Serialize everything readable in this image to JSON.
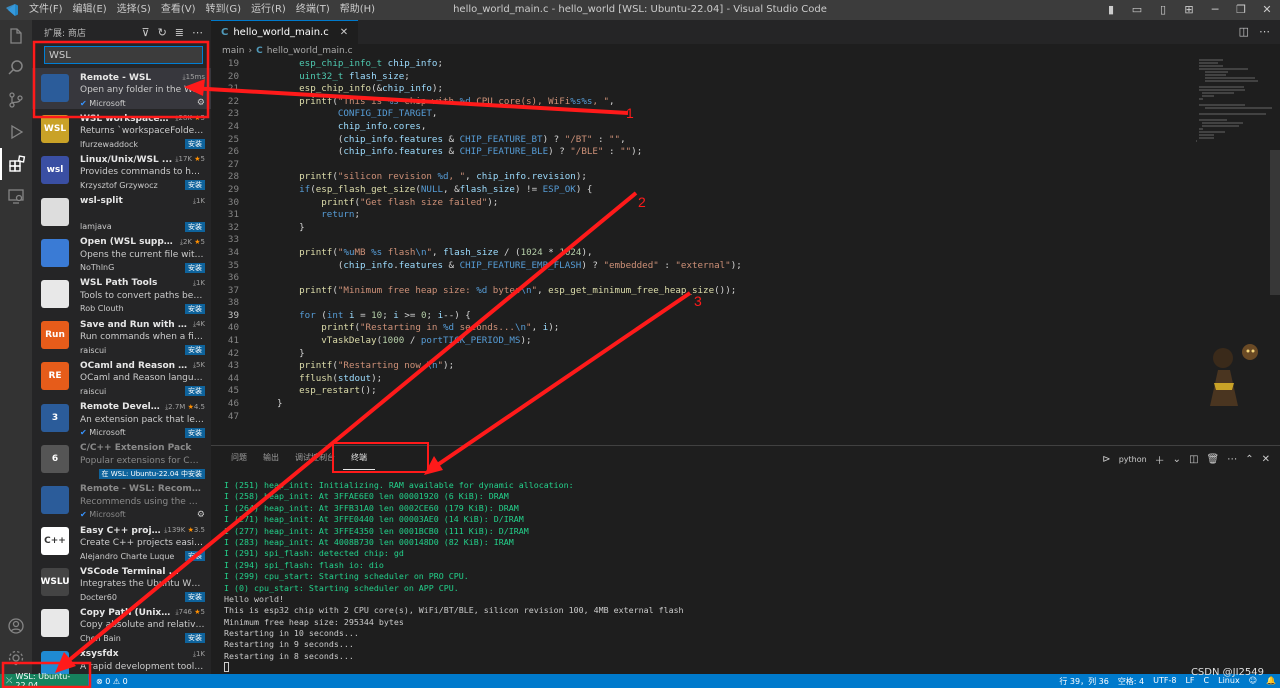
{
  "titlebar": {
    "menu": [
      "文件(F)",
      "编辑(E)",
      "选择(S)",
      "查看(V)",
      "转到(G)",
      "运行(R)",
      "终端(T)",
      "帮助(H)"
    ],
    "window_title": "hello_world_main.c - hello_world [WSL: Ubuntu-22.04] - Visual Studio Code"
  },
  "sidebar": {
    "title": "扩展: 商店",
    "search_value": "WSL",
    "extensions": [
      {
        "name": "Remote - WSL",
        "meta": "15ms",
        "desc": "Open any folder in the Windo...",
        "publisher": "Microsoft",
        "verified": true,
        "action": "gear",
        "icon_text": "",
        "icon_color": "#2b5c9a",
        "selected": true
      },
      {
        "name": "WSL workspaceF...",
        "meta": "28K",
        "rating": "5",
        "desc": "Returns `workspaceFolder` as a...",
        "publisher": "lfurzewaddock",
        "action": "安装",
        "icon_text": "WSL",
        "icon_color": "#c9a227"
      },
      {
        "name": "Linux/Unix/WSL ...",
        "meta": "17K",
        "rating": "5",
        "desc": "Provides commands to have u...",
        "publisher": "Krzysztof Grzywocz",
        "action": "安装",
        "icon_text": "wsl",
        "icon_color": "#3a4fa3"
      },
      {
        "name": "wsl-split",
        "meta": "1K",
        "desc": "",
        "publisher": "lamjava",
        "action": "安装",
        "icon_text": "",
        "icon_color": "#dddddd"
      },
      {
        "name": "Open (WSL support)",
        "meta": "2K",
        "rating": "5",
        "desc": "Opens the current file with the...",
        "publisher": "NoThlnG",
        "action": "安装",
        "icon_text": "",
        "icon_color": "#3a7bd5"
      },
      {
        "name": "WSL Path Tools",
        "meta": "1K",
        "desc": "Tools to convert paths betwee...",
        "publisher": "Rob Clouth",
        "action": "安装",
        "icon_text": "",
        "icon_color": "#e8e8e8"
      },
      {
        "name": "Save and Run with wsl",
        "meta": "4K",
        "desc": "Run commands when a file is s...",
        "publisher": "raiscui",
        "action": "安装",
        "icon_text": "Run",
        "icon_color": "#e65c1a"
      },
      {
        "name": "OCaml and Reason ID...",
        "meta": "5K",
        "desc": "OCaml and Reason language s...",
        "publisher": "raiscui",
        "action": "安装",
        "icon_text": "RE",
        "icon_color": "#e65c1a"
      },
      {
        "name": "Remote Develo...",
        "meta": "2.7M",
        "rating": "4.5",
        "desc": "An extension pack that lets yo...",
        "publisher": "Microsoft",
        "verified": true,
        "action": "安装",
        "icon_text": "3",
        "icon_color": "#2b5c9a"
      },
      {
        "name": "C/C++ Extension Pack",
        "meta": "",
        "desc": "Popular extensions for C++ de...",
        "publisher": "",
        "action": "在 WSL: Ubuntu-22.04 中安装",
        "icon_text": "6",
        "icon_color": "#555555",
        "dim": true
      },
      {
        "name": "Remote - WSL: Recommender",
        "meta": "",
        "desc": "Recommends using the Windo...",
        "publisher": "Microsoft",
        "verified": true,
        "action": "gear",
        "icon_text": "",
        "icon_color": "#2b5c9a",
        "dim": true
      },
      {
        "name": "Easy C++ proje...",
        "meta": "139K",
        "rating": "3.5",
        "desc": "Create C++ projects easily for ...",
        "publisher": "Alejandro Charte Luque",
        "action": "安装",
        "icon_text": "C++",
        "icon_color": "#ffffff"
      },
      {
        "name": "VSCode Terminal ...",
        "meta": "",
        "desc": "Integrates the Ubuntu WSL int...",
        "publisher": "Docter60",
        "action": "安装",
        "icon_text": "WSLU",
        "icon_color": "#444444"
      },
      {
        "name": "Copy Path (Unix ...",
        "meta": "746",
        "rating": "5",
        "desc": "Copy absolute and relative Wi...",
        "publisher": "Chen Bain",
        "action": "安装",
        "icon_text": "",
        "icon_color": "#e8e8e8"
      },
      {
        "name": "xsysfdx",
        "meta": "1K",
        "desc": "A rapid development tool for ...",
        "publisher": "",
        "action": "",
        "icon_text": "",
        "icon_color": "#1f8ad2"
      }
    ]
  },
  "editor": {
    "tab_label": "hello_world_main.c",
    "breadcrumb": [
      "main",
      "hello_world_main.c"
    ],
    "lines": [
      {
        "n": "19",
        "t": "    esp_chip_info_t chip_info;"
      },
      {
        "n": "20",
        "t": "    uint32_t flash_size;"
      },
      {
        "n": "21",
        "t": "    esp_chip_info(&chip_info);"
      },
      {
        "n": "22",
        "t": "    printf(\"This is %s chip with %d CPU core(s), WiFi%s%s, \","
      },
      {
        "n": "23",
        "t": "           CONFIG_IDF_TARGET,"
      },
      {
        "n": "24",
        "t": "           chip_info.cores,"
      },
      {
        "n": "25",
        "t": "           (chip_info.features & CHIP_FEATURE_BT) ? \"/BT\" : \"\","
      },
      {
        "n": "26",
        "t": "           (chip_info.features & CHIP_FEATURE_BLE) ? \"/BLE\" : \"\");"
      },
      {
        "n": "27",
        "t": ""
      },
      {
        "n": "28",
        "t": "    printf(\"silicon revision %d, \", chip_info.revision);"
      },
      {
        "n": "29",
        "t": "    if(esp_flash_get_size(NULL, &flash_size) != ESP_OK) {"
      },
      {
        "n": "30",
        "t": "        printf(\"Get flash size failed\");"
      },
      {
        "n": "31",
        "t": "        return;"
      },
      {
        "n": "32",
        "t": "    }"
      },
      {
        "n": "33",
        "t": ""
      },
      {
        "n": "34",
        "t": "    printf(\"%uMB %s flash\\n\", flash_size / (1024 * 1024),"
      },
      {
        "n": "35",
        "t": "           (chip_info.features & CHIP_FEATURE_EMB_FLASH) ? \"embedded\" : \"external\");"
      },
      {
        "n": "36",
        "t": ""
      },
      {
        "n": "37",
        "t": "    printf(\"Minimum free heap size: %d bytes\\n\", esp_get_minimum_free_heap_size());"
      },
      {
        "n": "38",
        "t": ""
      },
      {
        "n": "39",
        "t": "    for (int i = 10; i >= 0; i--) {"
      },
      {
        "n": "40",
        "t": "        printf(\"Restarting in %d seconds...\\n\", i);"
      },
      {
        "n": "41",
        "t": "        vTaskDelay(1000 / portTICK_PERIOD_MS);"
      },
      {
        "n": "42",
        "t": "    }"
      },
      {
        "n": "43",
        "t": "    printf(\"Restarting now.\\n\");"
      },
      {
        "n": "44",
        "t": "    fflush(stdout);"
      },
      {
        "n": "45",
        "t": "    esp_restart();"
      },
      {
        "n": "46",
        "t": "}"
      },
      {
        "n": "47",
        "t": ""
      }
    ]
  },
  "panel": {
    "tabs": [
      "问题",
      "输出",
      "调试控制台",
      "终端"
    ],
    "active_tab": "终端",
    "shell": "python",
    "terminal_lines": [
      {
        "t": "I (251) heap_init: Initializing. RAM available for dynamic allocation:",
        "g": true
      },
      {
        "t": "I (258) heap_init: At 3FFAE6E0 len 00001920 (6 KiB): DRAM",
        "g": true
      },
      {
        "t": "I (264) heap_init: At 3FFB31A0 len 0002CE60 (179 KiB): DRAM",
        "g": true
      },
      {
        "t": "I (271) heap_init: At 3FFE0440 len 00003AE0 (14 KiB): D/IRAM",
        "g": true
      },
      {
        "t": "I (277) heap_init: At 3FFE4350 len 0001BCB0 (111 KiB): D/IRAM",
        "g": true
      },
      {
        "t": "I (283) heap_init: At 4008B730 len 000148D0 (82 KiB): IRAM",
        "g": true
      },
      {
        "t": "I (291) spi_flash: detected chip: gd",
        "g": true
      },
      {
        "t": "I (294) spi_flash: flash io: dio",
        "g": true
      },
      {
        "t": "I (299) cpu_start: Starting scheduler on PRO CPU.",
        "g": true
      },
      {
        "t": "I (0) cpu_start: Starting scheduler on APP CPU.",
        "g": true
      },
      {
        "t": "Hello world!",
        "g": false
      },
      {
        "t": "This is esp32 chip with 2 CPU core(s), WiFi/BT/BLE, silicon revision 100, 4MB external flash",
        "g": false
      },
      {
        "t": "Minimum free heap size: 295344 bytes",
        "g": false
      },
      {
        "t": "Restarting in 10 seconds...",
        "g": false
      },
      {
        "t": "Restarting in 9 seconds...",
        "g": false
      },
      {
        "t": "Restarting in 8 seconds...",
        "g": false
      }
    ]
  },
  "statusbar": {
    "remote": "WSL: Ubuntu-22.04",
    "errors": "0",
    "warnings": "0",
    "position": "行 39，列 36",
    "spaces": "空格: 4",
    "encoding": "UTF-8",
    "eol": "LF",
    "lang": "C",
    "platform": "Linux"
  },
  "annotations": {
    "labels": [
      "1",
      "2",
      "3"
    ],
    "color": "#ff1a1a"
  },
  "watermark": "CSDN @JI2549",
  "colors": {
    "accent": "#007acc",
    "remote": "#16825d",
    "terminal_green": "#23d18b"
  }
}
